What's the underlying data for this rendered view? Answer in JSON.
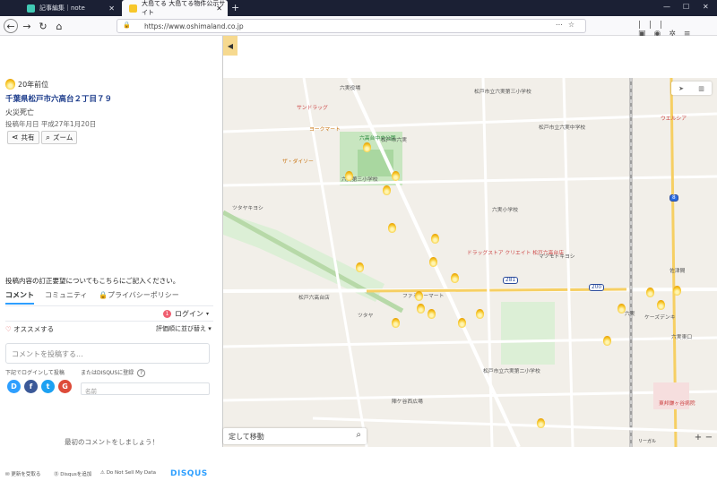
{
  "browser": {
    "tabs": [
      {
        "label": "記事編集｜note"
      },
      {
        "label": "大島てる 大島てる物件公示サイト"
      }
    ],
    "url": "https://www.oshimaland.co.jp"
  },
  "panel": {
    "years_ago": "20年前位",
    "address": "千葉県松戸市六高台２丁目７９",
    "cause": "火災死亡",
    "post_date": "投稿年月日 平成27年1月20日",
    "share_label": "共有",
    "zoom_label": "ズーム",
    "collapse_glyph": "◀"
  },
  "disqus": {
    "correction_note": "投稿内容の訂正要望についてもこちらにご記入ください。",
    "tabs": [
      "コメント",
      "コミュニティ",
      "プライバシーポリシー"
    ],
    "login_count": "1",
    "login_label": "ログイン",
    "recommend_label": "オススメする",
    "sort_label": "評価順に並び替え",
    "compose_placeholder": "コメントを投稿する...",
    "login_with_label": "下記でログインして投稿",
    "or_register_label": "またはDISQUSに登録",
    "name_placeholder": "名前",
    "social": [
      "D",
      "f",
      "t",
      "G"
    ],
    "first_comment": "最初のコメントをしましょう！",
    "footer": {
      "subscribe": "更新を受取る",
      "add": "Disqusを追加",
      "dnsmpi": "Do Not Sell My Data",
      "brand": "DISQUS"
    },
    "colors": {
      "accent": "#2e9fff",
      "disqus_blue": "#2e9fff"
    }
  },
  "map": {
    "search_text": "定して移動",
    "attribution": "リーガル",
    "zoom_in": "+",
    "zoom_out": "−",
    "labels": [
      "六実役場",
      "松戸市立六実第三小学校",
      "サンドラッグ",
      "ヨークマート",
      "六高台中央公園",
      "ザ・ダイソー",
      "六実第三小学校",
      "松戸市六実",
      "六実小学校",
      "ツタヤキヨシ",
      "松戸市立六実中学校",
      "ウエルシア",
      "ドラッグストア クリエイト 松戸六高台店",
      "マツモトキヨシ",
      "佐津間",
      "ファミリーマート",
      "松戸六高台店",
      "ツタヤ",
      "六実",
      "松戸市立六実第二小学校",
      "陣ケ谷西広場",
      "東邦鎌ヶ谷病院",
      "六実東口",
      "ケーズデンキ"
    ],
    "road_numbers": [
      "281",
      "200",
      "8"
    ]
  }
}
